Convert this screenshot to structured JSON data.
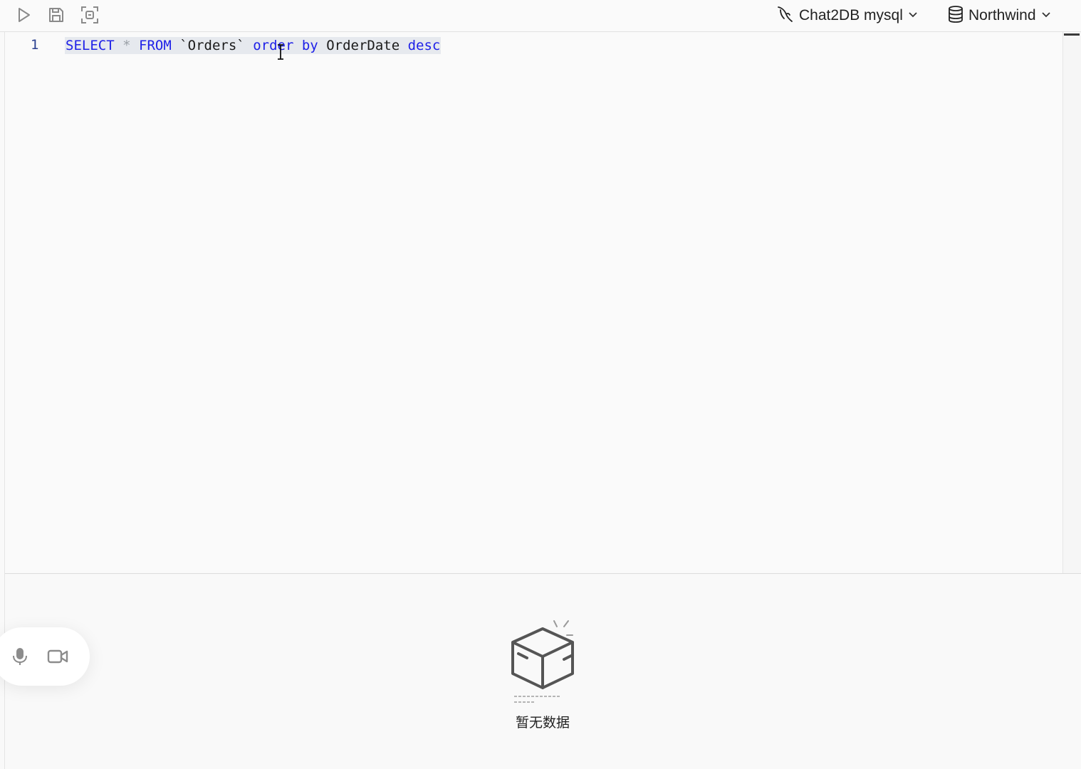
{
  "toolbar": {
    "run_icon": "play-icon",
    "save_icon": "save-icon",
    "format_icon": "format-scan-icon",
    "connection": {
      "icon": "mysql-dolphin-icon",
      "label": "Chat2DB mysql"
    },
    "database": {
      "icon": "database-icon",
      "label": "Northwind"
    }
  },
  "editor": {
    "lines": [
      {
        "number": "1",
        "tokens": {
          "t1": "SELECT",
          "t2": "*",
          "t3": "FROM",
          "t4": "`Orders`",
          "t5": "order",
          "t6": "by",
          "t7": "OrderDate",
          "t8": "desc"
        }
      }
    ]
  },
  "results": {
    "empty_icon": "empty-box-icon",
    "empty_text": "暂无数据"
  },
  "floating_widget": {
    "mic_icon": "microphone-icon",
    "camera_icon": "video-camera-icon"
  },
  "colors": {
    "keyword": "#1f21e8",
    "operator": "#9aa0a6",
    "identifier": "#1a1a1a",
    "selection": "#e6e9ee"
  }
}
